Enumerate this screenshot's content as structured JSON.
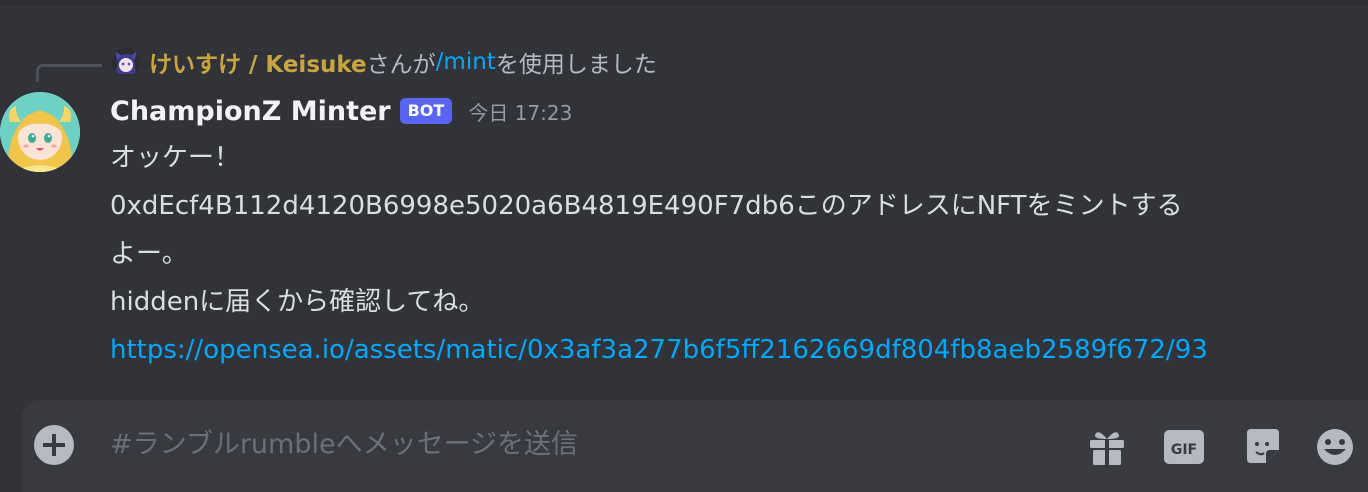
{
  "reply": {
    "username": "けいすけ / Keisuke",
    "text_before": "さんが",
    "command": "/mint",
    "text_after": "を使用しました"
  },
  "message": {
    "author": "ChampionZ Minter",
    "bot_tag": "BOT",
    "timestamp": "今日 17:23",
    "lines": [
      "オッケー！",
      "0xdEcf4B112d4120B6998e5020a6B4819E490F7db6このアドレスにNFTをミントする",
      "よー。",
      "hiddenに届くから確認してね。"
    ],
    "link": "https://opensea.io/assets/matic/0x3af3a277b6f5ff2162669df804fb8aeb2589f672/93"
  },
  "composer": {
    "placeholder": "#ランブルrumbleへメッセージを送信"
  },
  "icons": {
    "add": "plus-circle-icon",
    "gift": "gift-icon",
    "gif": "gif-icon",
    "sticker": "sticker-icon",
    "emoji": "emoji-icon"
  },
  "colors": {
    "background": "#313338",
    "composer": "#383a40",
    "bot_tag": "#5865f2",
    "link": "#00a8fc",
    "reply_user": "#c9a540"
  }
}
